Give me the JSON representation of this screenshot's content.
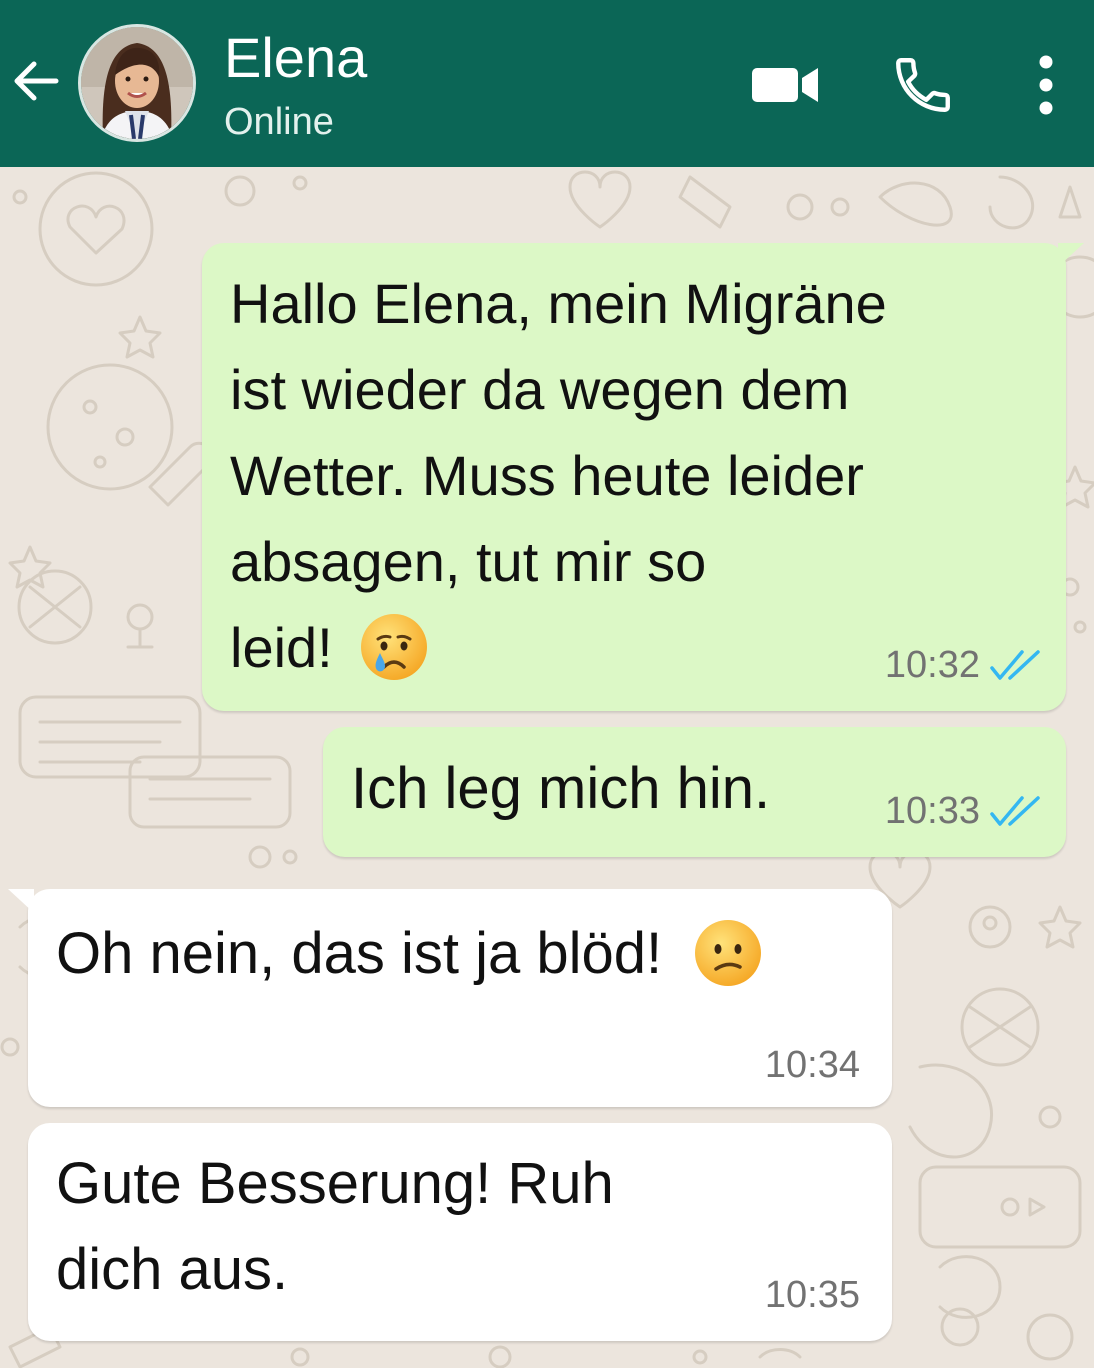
{
  "header": {
    "contact_name": "Elena",
    "status": "Online",
    "color": "#0b6656"
  },
  "icons": {
    "back": "arrow-left-icon",
    "video": "video-camera-icon",
    "call": "phone-icon",
    "menu": "more-vertical-icon",
    "read_receipt": "double-check-icon"
  },
  "colors": {
    "outgoing_bubble": "#dcf8c6",
    "incoming_bubble": "#ffffff",
    "read_ticks": "#34b7f1",
    "chat_background": "#ece5dd"
  },
  "messages": [
    {
      "direction": "outgoing",
      "lines": [
        "Hallo Elena, mein Migräne",
        "ist wieder da wegen dem",
        "Wetter. Muss heute leider",
        "absagen, tut mir so",
        "leid!"
      ],
      "emoji": "crying-face",
      "time": "10:32",
      "read": true
    },
    {
      "direction": "outgoing",
      "lines": [
        "Ich leg mich hin."
      ],
      "time": "10:33",
      "read": true
    },
    {
      "direction": "incoming",
      "lines": [
        "Oh nein, das ist ja blöd!"
      ],
      "emoji": "confused-face",
      "time": "10:34"
    },
    {
      "direction": "incoming",
      "lines": [
        "Gute Besserung! Ruh",
        "dich aus."
      ],
      "time": "10:35"
    }
  ]
}
